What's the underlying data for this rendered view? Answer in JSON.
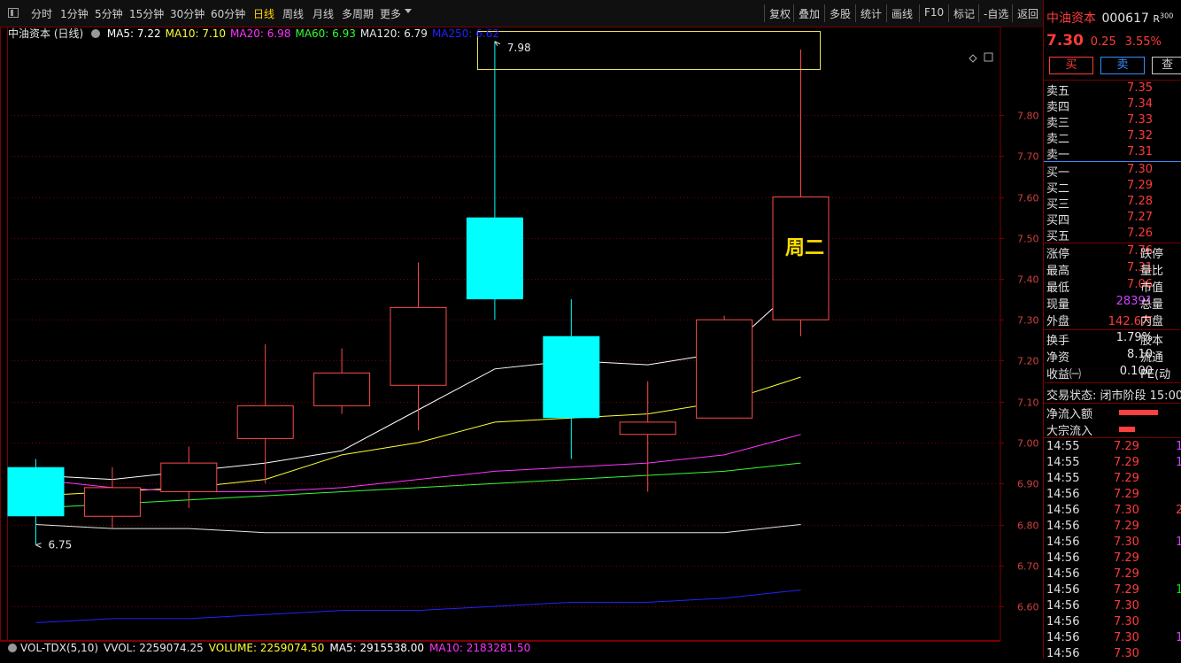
{
  "toolbar": {
    "periods": [
      "分时",
      "1分钟",
      "5分钟",
      "15分钟",
      "30分钟",
      "60分钟",
      "日线",
      "周线",
      "月线",
      "多周期",
      "更多"
    ],
    "active_period": "日线",
    "right_buttons": [
      "复权",
      "叠加",
      "多股",
      "统计",
      "画线",
      "F10",
      "标记",
      "-自选",
      "返回"
    ]
  },
  "chart": {
    "stock_label": "中油资本 (日线)",
    "ma": [
      {
        "label": "MA5: 7.22",
        "color": "#ffffff"
      },
      {
        "label": "MA10: 7.10",
        "color": "#ffff33"
      },
      {
        "label": "MA20: 6.98",
        "color": "#ff33ff"
      },
      {
        "label": "MA60: 6.93",
        "color": "#33ff33"
      },
      {
        "label": "MA120: 6.79",
        "color": "#e6e6e6"
      },
      {
        "label": "MA250: 6.62",
        "color": "#2222ff"
      }
    ],
    "high_label": "7.98",
    "low_label": "6.75",
    "annotation": "周二",
    "colors": {
      "up": "#ff4a4a",
      "down": "#00ffff",
      "grid": "#7a0000",
      "annotation": "#ffe000"
    }
  },
  "chart_data": {
    "type": "candlestick",
    "y_ticks": [
      6.6,
      6.7,
      6.8,
      6.9,
      7.0,
      7.1,
      7.2,
      7.3,
      7.4,
      7.5,
      7.6,
      7.7,
      7.8
    ],
    "ylim": [
      6.55,
      7.95
    ],
    "candles": [
      {
        "open": 6.94,
        "close": 6.82,
        "high": 6.96,
        "low": 6.75
      },
      {
        "open": 6.82,
        "close": 6.89,
        "high": 6.94,
        "low": 6.79
      },
      {
        "open": 6.88,
        "close": 6.95,
        "high": 6.99,
        "low": 6.84
      },
      {
        "open": 7.01,
        "close": 7.09,
        "high": 7.24,
        "low": 6.9
      },
      {
        "open": 7.09,
        "close": 7.17,
        "high": 7.23,
        "low": 7.07
      },
      {
        "open": 7.14,
        "close": 7.33,
        "high": 7.44,
        "low": 7.03
      },
      {
        "open": 7.55,
        "close": 7.35,
        "high": 7.98,
        "low": 7.3
      },
      {
        "open": 7.26,
        "close": 7.06,
        "high": 7.35,
        "low": 6.96
      },
      {
        "open": 7.02,
        "close": 7.05,
        "high": 7.15,
        "low": 6.88
      },
      {
        "open": 7.06,
        "close": 7.3,
        "high": 7.31,
        "low": 7.06
      },
      {
        "open": 7.3,
        "close": 7.6,
        "high": 7.96,
        "low": 7.26
      }
    ],
    "ma_lines": [
      {
        "name": "MA5",
        "color": "#ffffff",
        "values": [
          6.92,
          6.91,
          6.93,
          6.95,
          6.98,
          7.08,
          7.18,
          7.2,
          7.19,
          7.22,
          7.39
        ]
      },
      {
        "name": "MA10",
        "color": "#ffff33",
        "values": [
          6.87,
          6.88,
          6.89,
          6.91,
          6.97,
          7.0,
          7.05,
          7.06,
          7.07,
          7.1,
          7.16
        ]
      },
      {
        "name": "MA20",
        "color": "#ff33ff",
        "values": [
          6.91,
          6.89,
          6.88,
          6.88,
          6.89,
          6.91,
          6.93,
          6.94,
          6.95,
          6.97,
          7.02
        ]
      },
      {
        "name": "MA60",
        "color": "#33ff33",
        "values": [
          6.84,
          6.85,
          6.86,
          6.87,
          6.88,
          6.89,
          6.9,
          6.91,
          6.92,
          6.93,
          6.95
        ]
      },
      {
        "name": "MA120",
        "color": "#e6e6e6",
        "values": [
          6.8,
          6.79,
          6.79,
          6.78,
          6.78,
          6.78,
          6.78,
          6.78,
          6.78,
          6.78,
          6.8
        ]
      },
      {
        "name": "MA250",
        "color": "#2222ff",
        "values": [
          6.56,
          6.57,
          6.57,
          6.58,
          6.59,
          6.59,
          6.6,
          6.61,
          6.61,
          6.62,
          6.64
        ]
      }
    ]
  },
  "volume_bar": {
    "items": [
      {
        "label": "VOL-TDX(5,10)",
        "color": "#e6e6e6"
      },
      {
        "label": "VVOL: 2259074.25",
        "color": "#e6e6e6"
      },
      {
        "label": "VOLUME: 2259074.50",
        "color": "#ffff33"
      },
      {
        "label": "MA5: 2915538.00",
        "color": "#ffffff"
      },
      {
        "label": "MA10: 2183281.50",
        "color": "#ff33ff"
      }
    ]
  },
  "panel": {
    "name": "中油资本",
    "code": "000617",
    "badge": "R",
    "badge_sup": "300",
    "price": "7.30",
    "change": "0.25",
    "pct": "3.55%",
    "buttons": [
      "买",
      "卖",
      "查"
    ],
    "asks": [
      {
        "label": "卖五",
        "price": "7.35"
      },
      {
        "label": "卖四",
        "price": "7.34"
      },
      {
        "label": "卖三",
        "price": "7.33"
      },
      {
        "label": "卖二",
        "price": "7.32"
      },
      {
        "label": "卖一",
        "price": "7.31"
      }
    ],
    "bids": [
      {
        "label": "买一",
        "price": "7.30"
      },
      {
        "label": "买二",
        "price": "7.29"
      },
      {
        "label": "买三",
        "price": "7.28"
      },
      {
        "label": "买四",
        "price": "7.27"
      },
      {
        "label": "买五",
        "price": "7.26"
      }
    ],
    "stats": [
      {
        "label": "涨停",
        "value": "7.76",
        "vcls": "red",
        "extra": "跌停"
      },
      {
        "label": "最高",
        "value": "7.31",
        "vcls": "red",
        "extra": "量比"
      },
      {
        "label": "最低",
        "value": "7.06",
        "vcls": "red",
        "extra": "市值"
      },
      {
        "label": "现量",
        "value": "28391",
        "vcls": "purple",
        "extra": "总量"
      },
      {
        "label": "外盘",
        "value": "142.6万",
        "vcls": "red",
        "extra": "内盘"
      }
    ],
    "stats2": [
      {
        "label": "换手",
        "value": "1.79%",
        "extra": "股本"
      },
      {
        "label": "净资",
        "value": "8.10",
        "extra": "流通"
      },
      {
        "label": "收益㈠",
        "value": "0.100",
        "extra": "PE(动"
      }
    ],
    "trade_status": "交易状态: 闭市阶段 15:00",
    "flows": [
      {
        "label": "净流入额",
        "bar": 44
      },
      {
        "label": "大宗流入",
        "bar": 18
      }
    ],
    "ticks": [
      {
        "time": "14:55",
        "price": "7.29",
        "vol": "1",
        "vc": "purple"
      },
      {
        "time": "14:55",
        "price": "7.29",
        "vol": "1",
        "vc": "purple"
      },
      {
        "time": "14:55",
        "price": "7.29",
        "vol": "",
        "vc": ""
      },
      {
        "time": "14:56",
        "price": "7.29",
        "vol": "",
        "vc": ""
      },
      {
        "time": "14:56",
        "price": "7.30",
        "vol": "2",
        "vc": "red"
      },
      {
        "time": "14:56",
        "price": "7.29",
        "vol": "",
        "vc": ""
      },
      {
        "time": "14:56",
        "price": "7.30",
        "vol": "1",
        "vc": "purple"
      },
      {
        "time": "14:56",
        "price": "7.29",
        "vol": "",
        "vc": ""
      },
      {
        "time": "14:56",
        "price": "7.29",
        "vol": "",
        "vc": ""
      },
      {
        "time": "14:56",
        "price": "7.29",
        "vol": "1",
        "vc": "green"
      },
      {
        "time": "14:56",
        "price": "7.30",
        "vol": "",
        "vc": ""
      },
      {
        "time": "14:56",
        "price": "7.30",
        "vol": "",
        "vc": ""
      },
      {
        "time": "14:56",
        "price": "7.30",
        "vol": "1",
        "vc": "purple"
      },
      {
        "time": "14:56",
        "price": "7.30",
        "vol": "",
        "vc": ""
      }
    ]
  }
}
